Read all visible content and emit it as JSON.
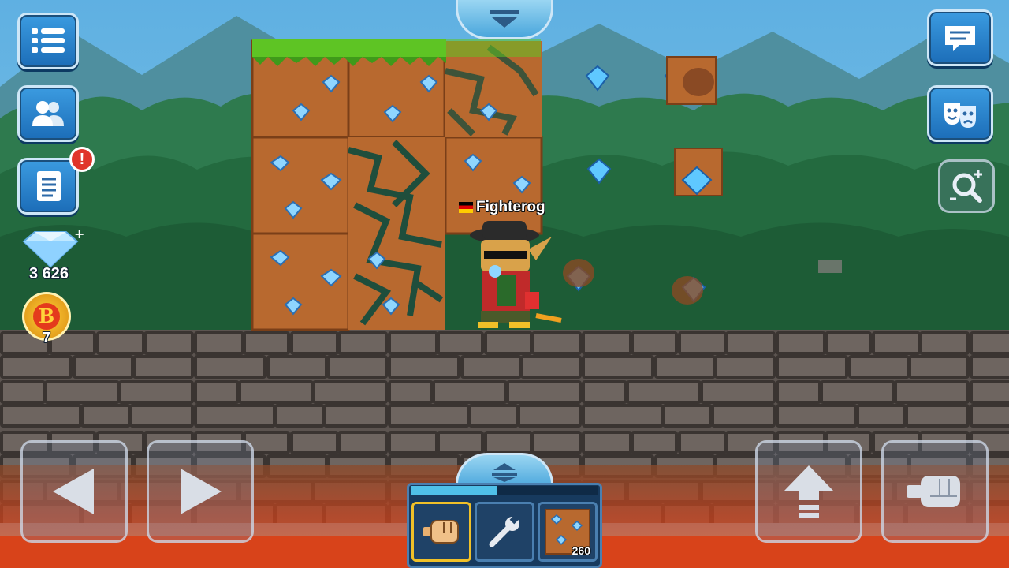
{
  "player": {
    "name": "Fighterog",
    "flag": "germany-flag"
  },
  "currency": {
    "gems": "3 626",
    "byte_coins": "7"
  },
  "left_menu": {
    "icons": [
      "menu-list-icon",
      "friends-icon",
      "quests-scroll-icon"
    ],
    "alert_badge": "!"
  },
  "right_menu": {
    "icons": [
      "chat-icon",
      "emotes-masks-icon",
      "zoom-icon"
    ]
  },
  "inventory": {
    "slots": [
      {
        "item": "fist-icon",
        "selected": true
      },
      {
        "item": "wrench-icon",
        "selected": false
      },
      {
        "item": "dirt-gem-block-icon",
        "count": "260",
        "selected": false
      }
    ]
  },
  "colors": {
    "ui_blue": "#1c6db8",
    "selected_slot": "#f0c028",
    "alert_red": "#e0352b"
  }
}
